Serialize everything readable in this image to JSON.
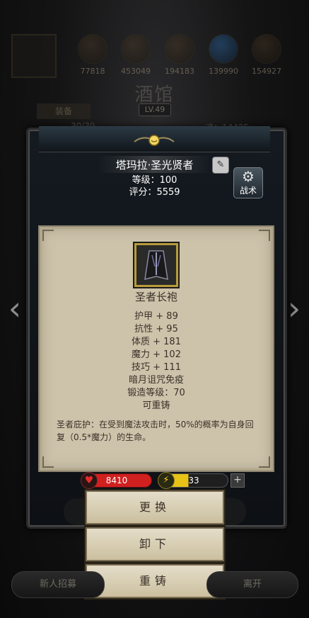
{
  "resources": [
    {
      "icon": "gold-orb-icon",
      "value": "77818"
    },
    {
      "icon": "coin-orb-icon",
      "value": "453049"
    },
    {
      "icon": "crystal-orb-icon",
      "value": "194183"
    },
    {
      "icon": "gem-orb-icon",
      "value": "139990"
    },
    {
      "icon": "scroll-orb-icon",
      "value": "154927"
    }
  ],
  "tavern": {
    "title": "酒馆",
    "level": "LV.49",
    "equip_tab": "装备",
    "count": "30/39",
    "soul": "魂：14425"
  },
  "hero": {
    "name": "塔玛拉·圣光贤者",
    "level": "等级：100",
    "score": "评分：5559",
    "tactic_label": "战术"
  },
  "item": {
    "name": "圣者长袍",
    "attributes": [
      "护甲 + 89",
      "抗性 + 95",
      "体质 + 181",
      "魔力 + 102",
      "技巧 + 111",
      "暗月诅咒免疫",
      "锻造等级：70",
      "可重铸"
    ],
    "description": "圣者庇护：在受到魔法攻击时，50%的概率为自身回复（0.5*魔力）的生命。"
  },
  "bars": {
    "hp": "8410",
    "energy": "33",
    "energy_fill": 0.42
  },
  "actions": {
    "replace": "更换",
    "unequip": "卸下",
    "reforge": "重铸"
  },
  "bottom": {
    "recruit": "新人招募",
    "leave": "离开"
  },
  "colors": {
    "hp": "#d02020",
    "energy": "#e7c318",
    "panel": "#cdc3ab",
    "frame_gold": "#b89b3c"
  }
}
